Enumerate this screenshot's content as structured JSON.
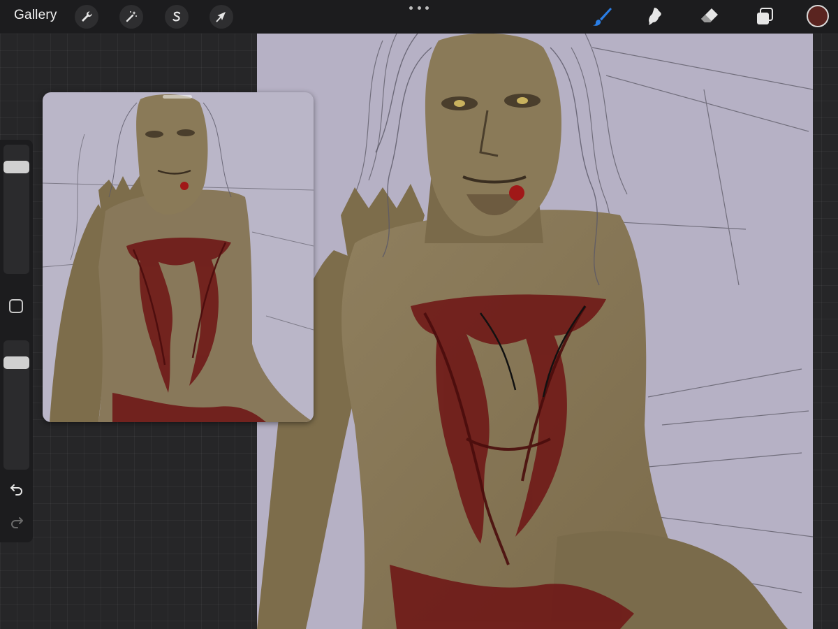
{
  "topbar": {
    "gallery_label": "Gallery",
    "left_tools": [
      {
        "icon": "wrench-icon",
        "name": "actions"
      },
      {
        "icon": "magic-wand-icon",
        "name": "adjustments"
      },
      {
        "icon": "selection-s-icon",
        "name": "selection"
      },
      {
        "icon": "arrow-cursor-icon",
        "name": "transform"
      }
    ],
    "right_tools": [
      {
        "icon": "brush-icon",
        "name": "paint",
        "active": true
      },
      {
        "icon": "smudge-icon",
        "name": "smudge",
        "active": false
      },
      {
        "icon": "eraser-icon",
        "name": "erase",
        "active": false
      },
      {
        "icon": "layers-icon",
        "name": "layers",
        "active": false
      }
    ],
    "current_color": "#5a2420",
    "accent_color": "#2a7ee6"
  },
  "sidebar": {
    "brush_size_level": 0.87,
    "opacity_level": 0.87,
    "modifier_icon": "square-icon",
    "undo_icon": "undo-icon",
    "redo_icon": "redo-icon"
  },
  "reference_window": {
    "visible": true
  }
}
